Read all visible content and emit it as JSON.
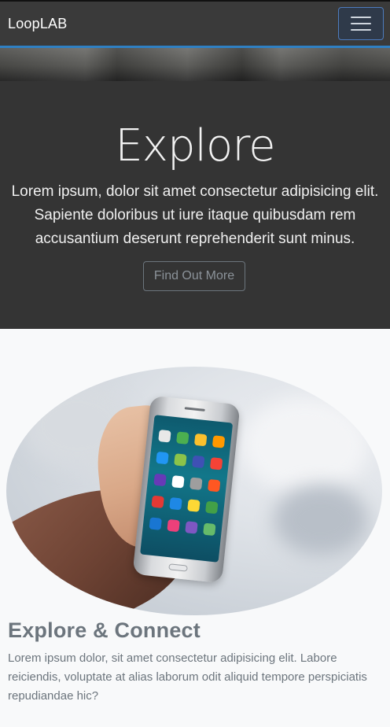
{
  "navbar": {
    "brand": "LoopLAB",
    "toggler_icon": "hamburger-icon"
  },
  "hero": {
    "title": "Explore",
    "text": "Lorem ipsum, dolor sit amet consectetur adipisicing elit. Sapiente doloribus ut iure itaque quibusdam rem accusantium deserunt reprehenderit sunt minus.",
    "button_label": "Find Out More"
  },
  "section": {
    "image_subject": "hand-holding-smartphone",
    "title": "Explore & Connect",
    "text": "Lorem ipsum dolor, sit amet consectetur adipisicing elit. Labore reiciendis, voluptate at alias laborum odit aliquid tempore perspiciatis repudiandae hic?"
  },
  "colors": {
    "navbar_bg": "#3a3a3a",
    "navbar_accent": "#2f80c3",
    "hero_bg": "#343434",
    "page_bg": "#f8f9fa",
    "muted_text": "#6c757d"
  }
}
